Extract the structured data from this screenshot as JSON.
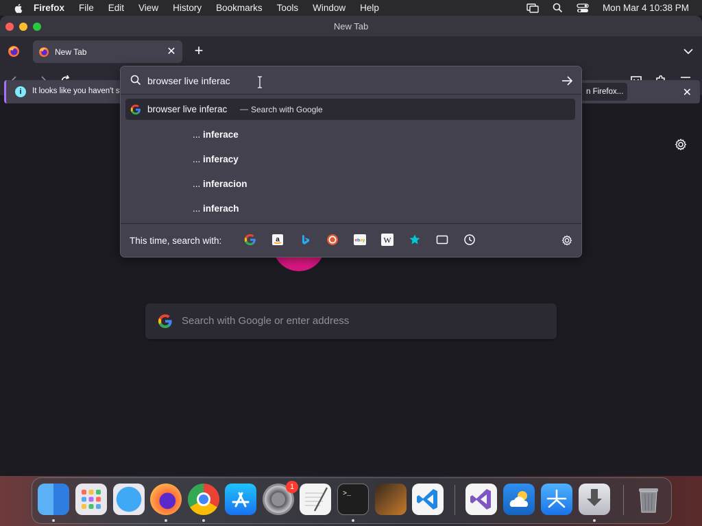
{
  "menubar": {
    "app_name": "Firefox",
    "items": [
      "File",
      "Edit",
      "View",
      "History",
      "Bookmarks",
      "Tools",
      "Window",
      "Help"
    ],
    "clock": "Mon Mar 4  10:38 PM"
  },
  "window": {
    "title": "New Tab"
  },
  "tabs": [
    {
      "label": "New Tab"
    }
  ],
  "notification": {
    "text": "It looks like you haven't st",
    "button_label": "n Firefox..."
  },
  "urlbar": {
    "value": "browser live inferac",
    "main_suggestion": {
      "query": "browser live inferac",
      "separator": "—",
      "action": "Search with Google"
    },
    "suggestions": [
      {
        "prefix": "...",
        "text": "inferace"
      },
      {
        "prefix": "...",
        "text": "inferacy"
      },
      {
        "prefix": "...",
        "text": "inferacion"
      },
      {
        "prefix": "...",
        "text": "inferach"
      }
    ],
    "search_with_label": "This time, search with:",
    "engines": [
      "google-icon",
      "amazon-icon",
      "bing-icon",
      "duckduckgo-icon",
      "ebay-icon",
      "wikipedia-icon",
      "bookmarks-icon",
      "tabs-icon",
      "history-icon"
    ]
  },
  "newtab": {
    "search_placeholder": "Search with Google or enter address"
  },
  "dock": {
    "apps": [
      "finder",
      "launchpad",
      "safari",
      "firefox",
      "chrome",
      "app-store",
      "system-settings",
      "textedit",
      "terminal",
      "garageband",
      "vscode",
      "visual-studio",
      "cloud-app",
      "xcode-instruments",
      "installer",
      "trash"
    ],
    "system_settings_badge": "1"
  },
  "colors": {
    "accent": "#a970ff",
    "toolbar": "#2b2a33",
    "urlbar": "#42414d",
    "content": "#1c1b22"
  }
}
